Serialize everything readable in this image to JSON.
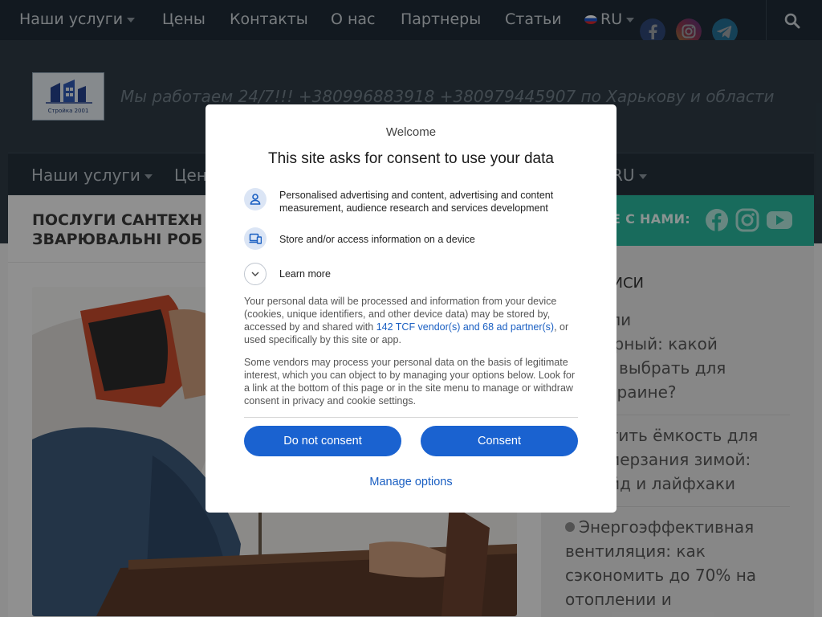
{
  "topnav": {
    "items": [
      "Наши услуги",
      "Цены",
      "Контакты",
      "О нас",
      "Партнеры",
      "Статьи"
    ],
    "lang": "RU"
  },
  "header": {
    "logo_text": "Стройка 2001",
    "tagline": "Мы работаем 24/7!!! +380996883918 +380979445907 по Харькову и области"
  },
  "secnav": {
    "items": [
      "Наши услуги",
      "Цен"
    ],
    "lang": "RU"
  },
  "post": {
    "title_line1": "ПОСЛУГИ САНТЕХН",
    "title_line2": "ЗВАРЮВАЛЬНІ РОБ"
  },
  "follow": {
    "label": "Е С НАМИ:"
  },
  "sidebar": {
    "recent_title": "Е ЗАПИСИ",
    "links": [
      [
        "вой или",
        "улятoрный: какой",
        "оверт выбрать для",
        "ы в Украине?"
      ],
      [
        "защитить ёмкость для",
        "от замерзания зимой:",
        "ий гайд и лайфхаки"
      ],
      [
        "Энергоэффективная",
        "вентиляция: как",
        "сэкономить до 70% на",
        "отоплении и"
      ]
    ]
  },
  "consent": {
    "welcome": "Welcome",
    "heading": "This site asks for consent to use your data",
    "purpose1": "Personalised advertising and content, advertising and content measurement, audience research and services development",
    "purpose2": "Store and/or access information on a device",
    "learn_more": "Learn more",
    "para1_before": "Your personal data will be processed and information from your device (cookies, unique identifiers, and other device data) may be stored by, accessed by and shared with ",
    "para1_link": "142 TCF vendor(s) and 68 ad partner(s)",
    "para1_after": ", or used specifically by this site or app.",
    "para2": "Some vendors may process your personal data on the basis of legitimate interest, which you can object to by managing your options below. Look for a link at the bottom of this page or in the site menu to manage or withdraw consent in privacy and cookie settings.",
    "do_not_consent": "Do not consent",
    "consent_btn": "Consent",
    "manage_options": "Manage options"
  },
  "colors": {
    "nav_bg": "#1e2b36",
    "header_bg": "#2d3a44",
    "accent_teal": "#29b39a",
    "button_blue": "#1a62d0",
    "link_blue": "#1a5fc2"
  },
  "icons": [
    "caret-down-icon",
    "flag-ru-icon",
    "facebook-icon",
    "instagram-icon",
    "telegram-icon",
    "youtube-icon",
    "search-icon",
    "person-icon",
    "devices-icon",
    "chevron-down-icon",
    "clock-icon"
  ]
}
